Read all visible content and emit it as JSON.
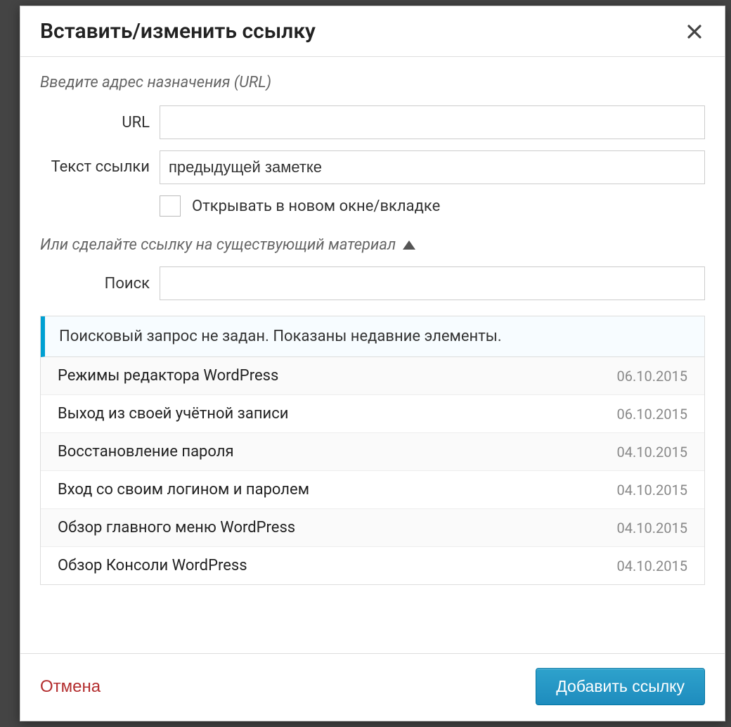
{
  "dialog": {
    "title": "Вставить/изменить ссылку",
    "section_url_hint": "Введите адрес назначения (URL)",
    "url_label": "URL",
    "url_value": "",
    "text_label": "Текст ссылки",
    "text_value": "предыдущей заметке",
    "open_new_tab_label": "Открывать в новом окне/вкладке",
    "section_existing_hint": "Или сделайте ссылку на существующий материал",
    "search_label": "Поиск",
    "search_value": "",
    "results_hint": "Поисковый запрос не задан. Показаны недавние элементы.",
    "results": [
      {
        "title": "Режимы редактора WordPress",
        "date": "06.10.2015"
      },
      {
        "title": "Выход из своей учётной записи",
        "date": "06.10.2015"
      },
      {
        "title": "Восстановление пароля",
        "date": "04.10.2015"
      },
      {
        "title": "Вход со своим логином и паролем",
        "date": "04.10.2015"
      },
      {
        "title": "Обзор главного меню WordPress",
        "date": "04.10.2015"
      },
      {
        "title": "Обзор Консоли WordPress",
        "date": "04.10.2015"
      }
    ],
    "cancel_label": "Отмена",
    "submit_label": "Добавить ссылку"
  }
}
